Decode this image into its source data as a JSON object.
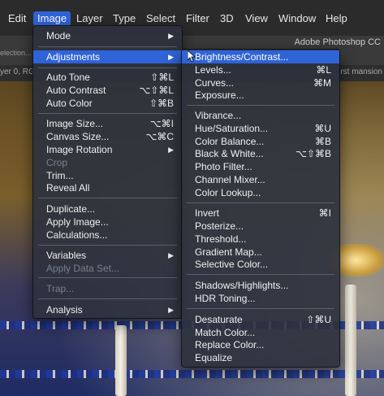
{
  "menubar": {
    "items": [
      {
        "label": "Edit",
        "active": false
      },
      {
        "label": "Image",
        "active": true
      },
      {
        "label": "Layer",
        "active": false
      },
      {
        "label": "Type",
        "active": false
      },
      {
        "label": "Select",
        "active": false
      },
      {
        "label": "Filter",
        "active": false
      },
      {
        "label": "3D",
        "active": false
      },
      {
        "label": "View",
        "active": false
      },
      {
        "label": "Window",
        "active": false
      },
      {
        "label": "Help",
        "active": false
      }
    ]
  },
  "app_title": "Adobe Photoshop CC",
  "options_bar": {
    "selection_hint": "election..."
  },
  "doc_tabs": {
    "left": "yer 0, RG",
    "right": "rst mansion"
  },
  "image_menu": {
    "items": [
      {
        "label": "Mode",
        "shortcut": "",
        "submenu": true,
        "disabled": false
      },
      {
        "label": "Adjustments",
        "shortcut": "",
        "submenu": true,
        "disabled": false,
        "highlighted": true
      },
      {
        "label": "Auto Tone",
        "shortcut": "⇧⌘L",
        "submenu": false,
        "disabled": false
      },
      {
        "label": "Auto Contrast",
        "shortcut": "⌥⇧⌘L",
        "submenu": false,
        "disabled": false
      },
      {
        "label": "Auto Color",
        "shortcut": "⇧⌘B",
        "submenu": false,
        "disabled": false
      },
      {
        "label": "Image Size...",
        "shortcut": "⌥⌘I",
        "submenu": false,
        "disabled": false
      },
      {
        "label": "Canvas Size...",
        "shortcut": "⌥⌘C",
        "submenu": false,
        "disabled": false
      },
      {
        "label": "Image Rotation",
        "shortcut": "",
        "submenu": true,
        "disabled": false
      },
      {
        "label": "Crop",
        "shortcut": "",
        "submenu": false,
        "disabled": true
      },
      {
        "label": "Trim...",
        "shortcut": "",
        "submenu": false,
        "disabled": false
      },
      {
        "label": "Reveal All",
        "shortcut": "",
        "submenu": false,
        "disabled": false
      },
      {
        "label": "Duplicate...",
        "shortcut": "",
        "submenu": false,
        "disabled": false
      },
      {
        "label": "Apply Image...",
        "shortcut": "",
        "submenu": false,
        "disabled": false
      },
      {
        "label": "Calculations...",
        "shortcut": "",
        "submenu": false,
        "disabled": false
      },
      {
        "label": "Variables",
        "shortcut": "",
        "submenu": true,
        "disabled": false
      },
      {
        "label": "Apply Data Set...",
        "shortcut": "",
        "submenu": false,
        "disabled": true
      },
      {
        "label": "Trap...",
        "shortcut": "",
        "submenu": false,
        "disabled": true
      },
      {
        "label": "Analysis",
        "shortcut": "",
        "submenu": true,
        "disabled": false
      }
    ]
  },
  "adjustments_menu": {
    "items": [
      {
        "label": "Brightness/Contrast...",
        "shortcut": "",
        "highlighted": true
      },
      {
        "label": "Levels...",
        "shortcut": "⌘L"
      },
      {
        "label": "Curves...",
        "shortcut": "⌘M"
      },
      {
        "label": "Exposure...",
        "shortcut": ""
      },
      {
        "label": "Vibrance...",
        "shortcut": ""
      },
      {
        "label": "Hue/Saturation...",
        "shortcut": "⌘U"
      },
      {
        "label": "Color Balance...",
        "shortcut": "⌘B"
      },
      {
        "label": "Black & White...",
        "shortcut": "⌥⇧⌘B"
      },
      {
        "label": "Photo Filter...",
        "shortcut": ""
      },
      {
        "label": "Channel Mixer...",
        "shortcut": ""
      },
      {
        "label": "Color Lookup...",
        "shortcut": ""
      },
      {
        "label": "Invert",
        "shortcut": "⌘I"
      },
      {
        "label": "Posterize...",
        "shortcut": ""
      },
      {
        "label": "Threshold...",
        "shortcut": ""
      },
      {
        "label": "Gradient Map...",
        "shortcut": ""
      },
      {
        "label": "Selective Color...",
        "shortcut": ""
      },
      {
        "label": "Shadows/Highlights...",
        "shortcut": ""
      },
      {
        "label": "HDR Toning...",
        "shortcut": ""
      },
      {
        "label": "Desaturate",
        "shortcut": "⇧⌘U"
      },
      {
        "label": "Match Color...",
        "shortcut": ""
      },
      {
        "label": "Replace Color...",
        "shortcut": ""
      },
      {
        "label": "Equalize",
        "shortcut": ""
      }
    ]
  },
  "icons": {
    "submenu_arrow": "triangle-right-icon",
    "cursor": "arrow-pointer-icon"
  },
  "colors": {
    "highlight": "#2f63d8",
    "menu_bg": "#2e323e",
    "disabled_text": "#7b7f8a"
  }
}
